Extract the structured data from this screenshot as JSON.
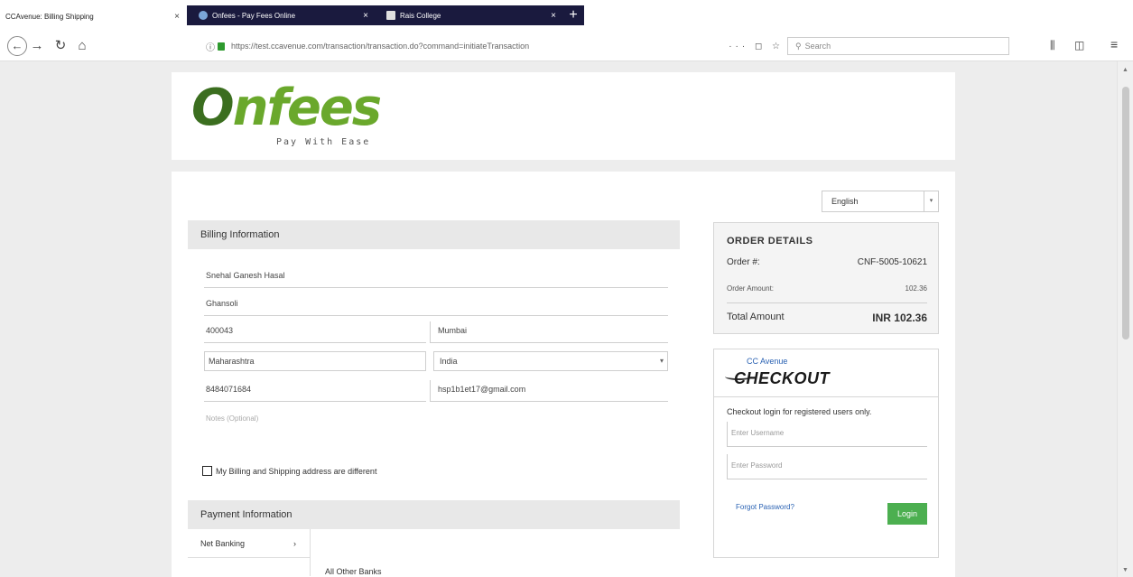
{
  "browser": {
    "tabs": [
      {
        "title": "CCAvenue: Billing Shipping",
        "close": "×"
      },
      {
        "title": "Onfees - Pay Fees Online",
        "close": "×"
      },
      {
        "title": "Rais College",
        "close": "×"
      }
    ],
    "new_tab": "+",
    "url": "https://test.ccavenue.com/transaction/transaction.do?command=initiateTransaction",
    "url_icons": "··· ◻ ☆",
    "search_placeholder": "Search",
    "icons": {
      "back": "←",
      "forward": "→",
      "reload": "↻",
      "home": "⌂",
      "library": "⫼",
      "sidebar": "◫",
      "menu": "≡"
    }
  },
  "header": {
    "logo_o": "O",
    "logo_rest": "nfees",
    "tagline": "Pay With Ease"
  },
  "language": {
    "selected": "English",
    "chevron": "▾"
  },
  "billing": {
    "heading": "Billing Information",
    "name": "Snehal Ganesh Hasal",
    "address": "Ghansoli",
    "zip": "400043",
    "city": "Mumbai",
    "state": "Maharashtra",
    "country": "India",
    "country_chevron": "▾",
    "phone": "8484071684",
    "email": "hsp1b1et17@gmail.com",
    "notes_placeholder": "Notes (Optional)",
    "diff_address_label": "My Billing and Shipping address are different"
  },
  "payment": {
    "heading": "Payment Information",
    "method": "Net Banking",
    "method_arrow": "›",
    "banks_label": "All Other Banks"
  },
  "order": {
    "title": "ORDER DETAILS",
    "order_num_label": "Order #:",
    "order_num": "CNF-5005-10621",
    "amount_label": "Order Amount:",
    "amount": "102.36",
    "total_label": "Total Amount",
    "total": "INR 102.36"
  },
  "checkout": {
    "brand_small": "CC Avenue",
    "brand_big": "CHECKOUT",
    "note": "Checkout login for registered users only.",
    "username_placeholder": "Enter Username",
    "password_placeholder": "Enter Password",
    "forgot": "Forgot Password?",
    "login": "Login"
  },
  "colors": {
    "logo_dark_green": "#3b6e1f",
    "logo_green": "#6aa82c",
    "login_green": "#4caf50",
    "link_blue": "#2a62b3"
  }
}
